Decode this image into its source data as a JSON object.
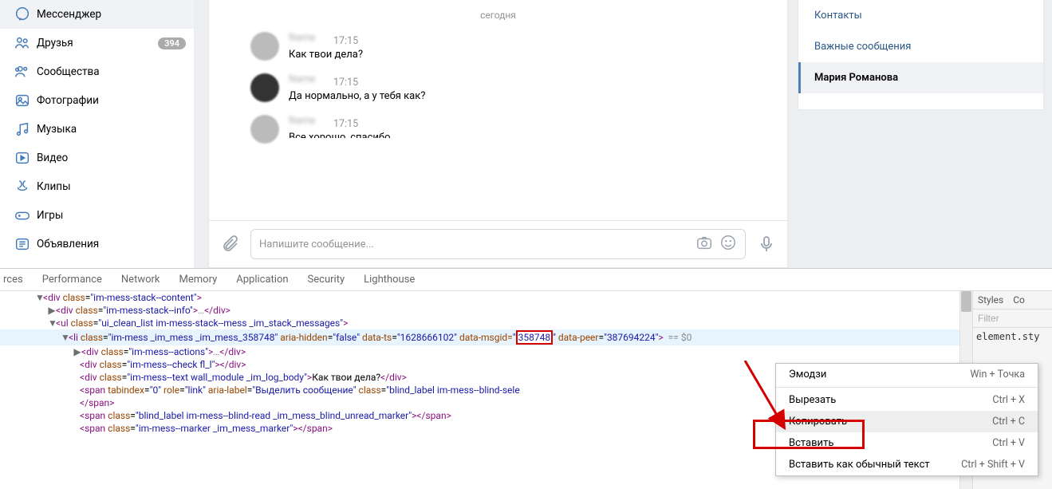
{
  "sidebar": {
    "items": [
      {
        "label": "Мессенджер",
        "icon": "messenger-icon"
      },
      {
        "label": "Друзья",
        "icon": "friends-icon",
        "badge": "394"
      },
      {
        "label": "Сообщества",
        "icon": "communities-icon"
      },
      {
        "label": "Фотографии",
        "icon": "photos-icon"
      },
      {
        "label": "Музыка",
        "icon": "music-icon"
      },
      {
        "label": "Видео",
        "icon": "video-icon"
      },
      {
        "label": "Клипы",
        "icon": "clips-icon"
      },
      {
        "label": "Игры",
        "icon": "games-icon"
      },
      {
        "label": "Объявления",
        "icon": "ads-icon"
      }
    ]
  },
  "chat": {
    "date_separator": "сегодня",
    "messages": [
      {
        "time": "17:15",
        "text": "Как твои дела?"
      },
      {
        "time": "17:15",
        "text": "Да нормально, а у тебя как?"
      },
      {
        "time": "17:15",
        "text": "Все хорошо, спасибо"
      }
    ],
    "composer_placeholder": "Напишите сообщение..."
  },
  "right_panel": {
    "items": [
      {
        "label": "Контакты"
      },
      {
        "label": "Важные сообщения"
      },
      {
        "label": "Мария Романова",
        "active": true
      }
    ]
  },
  "devtools": {
    "tabs": [
      "rces",
      "Performance",
      "Network",
      "Memory",
      "Application",
      "Security",
      "Lighthouse"
    ],
    "side_tabs": [
      "Styles",
      "Co"
    ],
    "filter_placeholder": "Filter",
    "style_body": "element.sty",
    "dom": {
      "l1": {
        "cls": "im-mess-stack--content"
      },
      "l2": {
        "cls": "im-mess-stack--info"
      },
      "l3": {
        "cls": "ui_clean_list im-mess-stack--mess _im_stack_messages"
      },
      "l4": {
        "cls": "im-mess _im_mess _im_mess_358748",
        "aria_hidden": "false",
        "data_ts": "1628666102",
        "data_msgid_label": "data-msgid=",
        "data_msgid_val": "358748",
        "data_peer": "387694224",
        "tail": "== $0"
      },
      "l5": {
        "cls": "im-mess--actions"
      },
      "l6": {
        "cls": "im-mess--check fl_l"
      },
      "l7": {
        "cls": "im-mess--text wall_module _im_log_body",
        "text": "Как твои дела?"
      },
      "l8": {
        "tabindex": "0",
        "role": "link",
        "aria_label": "Выделить сообщение",
        "cls": "blind_label im-mess--blind-sele"
      },
      "l9": {
        "close": "span"
      },
      "l10": {
        "cls": "blind_label im-mess--blind-read _im_mess_blind_unread_marker"
      },
      "l11": {
        "cls": "im-mess--marker _im_mess_marker"
      }
    }
  },
  "context_menu": {
    "items": [
      {
        "label": "Эмодзи",
        "shortcut": "Win + Точка"
      },
      {
        "label": "Вырезать",
        "shortcut": "Ctrl + X"
      },
      {
        "label": "Копировать",
        "shortcut": "Ctrl + C",
        "selected": true
      },
      {
        "label": "Вставить",
        "shortcut": "Ctrl + V"
      },
      {
        "label": "Вставить как обычный текст",
        "shortcut": "Ctrl + Shift + V"
      }
    ]
  }
}
